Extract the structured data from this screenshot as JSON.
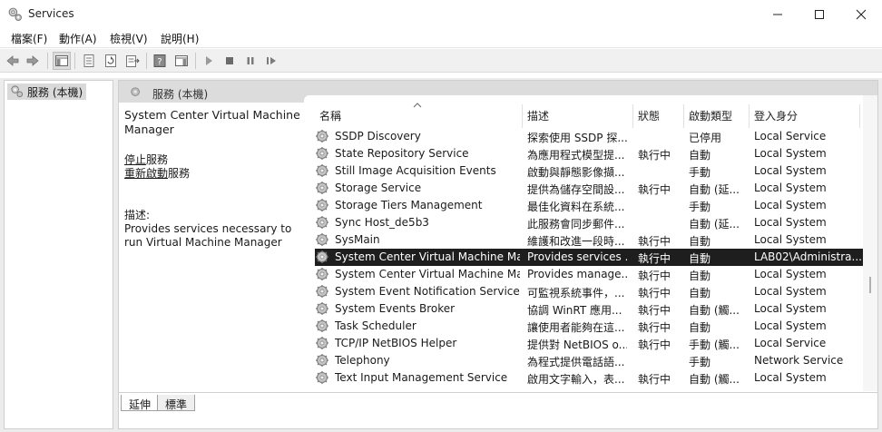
{
  "window": {
    "title": "Services"
  },
  "menu": [
    {
      "label": "檔案(F)"
    },
    {
      "label": "動作(A)"
    },
    {
      "label": "檢視(V)"
    },
    {
      "label": "說明(H)"
    }
  ],
  "tree": {
    "item": "服務 (本機)"
  },
  "main": {
    "header": "服務 (本機)",
    "selected_name": "System Center Virtual Machine Manager",
    "stop_link": "停止",
    "stop_suffix": "服務",
    "restart_link": "重新啟動",
    "restart_suffix": "服務",
    "desc_label": "描述:",
    "desc_text": "Provides services necessary to run Virtual Machine Manager"
  },
  "columns": [
    "名稱",
    "描述",
    "狀態",
    "啟動類型",
    "登入身分"
  ],
  "rows": [
    {
      "name": "SSDP Discovery",
      "desc": "探索使用 SSDP 探...",
      "status": "",
      "startup": "已停用",
      "logon": "Local Service"
    },
    {
      "name": "State Repository Service",
      "desc": "為應用程式模型提...",
      "status": "執行中",
      "startup": "自動",
      "logon": "Local System"
    },
    {
      "name": "Still Image Acquisition Events",
      "desc": "啟動與靜態影像擷...",
      "status": "",
      "startup": "手動",
      "logon": "Local System"
    },
    {
      "name": "Storage Service",
      "desc": "提供為儲存空間設...",
      "status": "執行中",
      "startup": "自動 (延...",
      "logon": "Local System"
    },
    {
      "name": "Storage Tiers Management",
      "desc": "最佳化資料在系統...",
      "status": "",
      "startup": "手動",
      "logon": "Local System"
    },
    {
      "name": "Sync Host_de5b3",
      "desc": "此服務會同步郵件...",
      "status": "",
      "startup": "自動 (延...",
      "logon": "Local System"
    },
    {
      "name": "SysMain",
      "desc": "維護和改進一段時...",
      "status": "執行中",
      "startup": "自動",
      "logon": "Local System"
    },
    {
      "name": "System Center Virtual Machine Ma...",
      "desc": "Provides services ...",
      "status": "執行中",
      "startup": "自動",
      "logon": "LAB02\\Administra...",
      "selected": true
    },
    {
      "name": "System Center Virtual Machine Ma...",
      "desc": "Provides manage...",
      "status": "執行中",
      "startup": "自動",
      "logon": "Local System"
    },
    {
      "name": "System Event Notification Service",
      "desc": "可監視系統事件，...",
      "status": "執行中",
      "startup": "自動",
      "logon": "Local System"
    },
    {
      "name": "System Events Broker",
      "desc": "協調 WinRT 應用...",
      "status": "執行中",
      "startup": "自動 (觸...",
      "logon": "Local System"
    },
    {
      "name": "Task Scheduler",
      "desc": "讓使用者能夠在這...",
      "status": "執行中",
      "startup": "自動",
      "logon": "Local System"
    },
    {
      "name": "TCP/IP NetBIOS Helper",
      "desc": "提供對 NetBIOS o...",
      "status": "執行中",
      "startup": "手動 (觸...",
      "logon": "Local Service"
    },
    {
      "name": "Telephony",
      "desc": "為程式提供電話語...",
      "status": "",
      "startup": "手動",
      "logon": "Network Service"
    },
    {
      "name": "Text Input Management Service",
      "desc": "啟用文字輸入，表...",
      "status": "執行中",
      "startup": "自動 (觸...",
      "logon": "Local System"
    }
  ],
  "tabs": [
    "延伸",
    "標準"
  ]
}
